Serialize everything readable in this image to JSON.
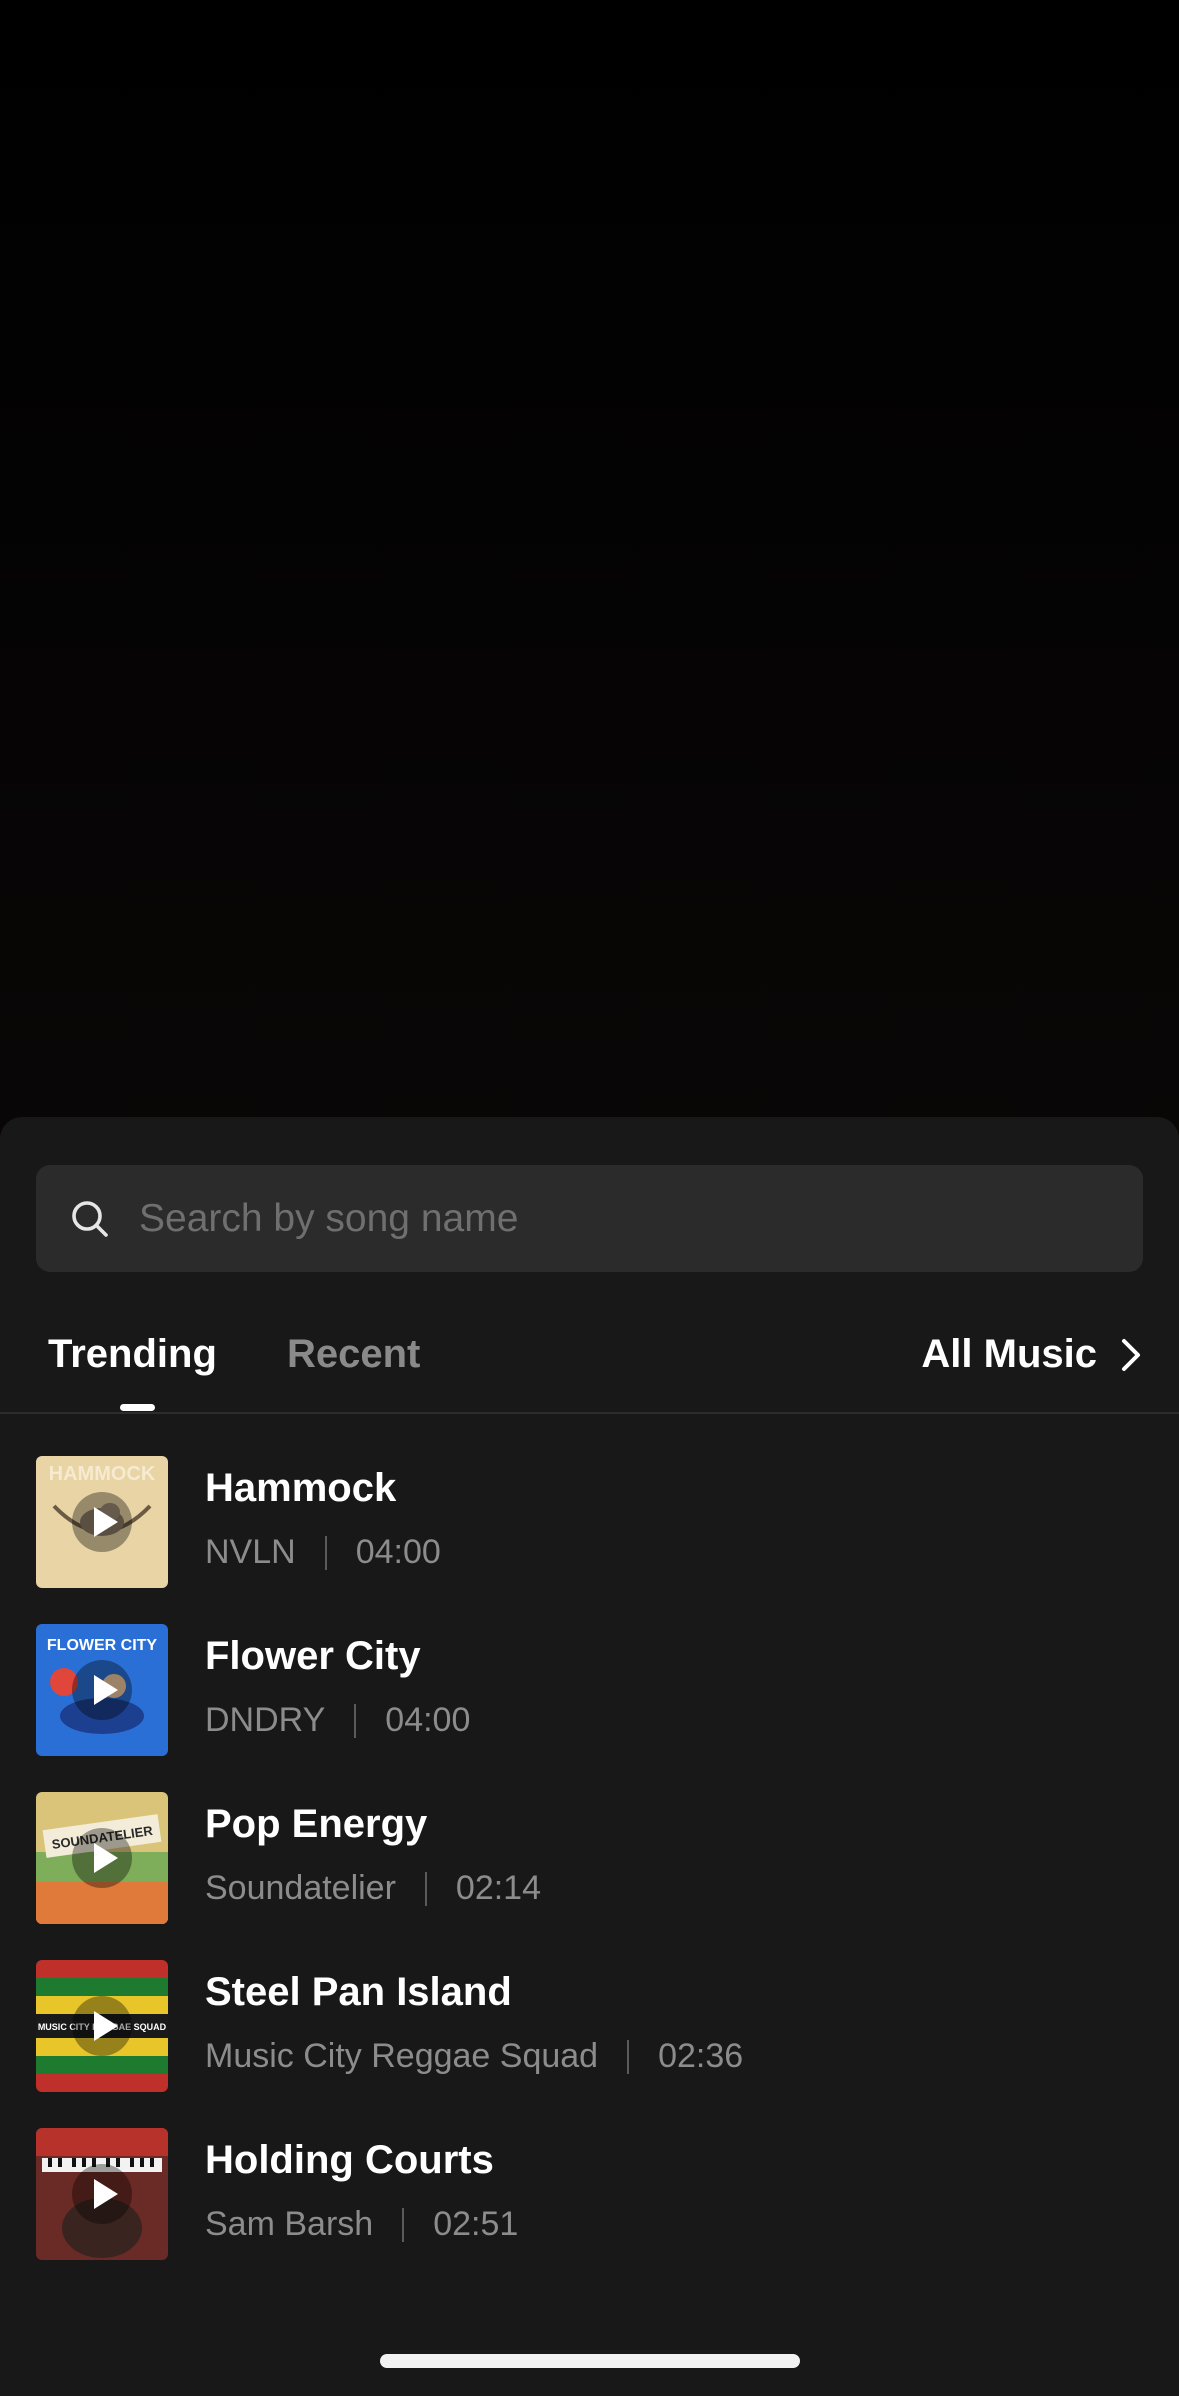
{
  "search": {
    "placeholder": "Search by song name",
    "icon": "search-icon"
  },
  "tabs": [
    {
      "label": "Trending",
      "active": true
    },
    {
      "label": "Recent",
      "active": false
    }
  ],
  "all_music": {
    "label": "All Music",
    "icon": "chevron-right-icon"
  },
  "songs": [
    {
      "title": "Hammock",
      "artist": "NVLN",
      "duration": "04:00",
      "cover_text": "HAMMOCK",
      "cover_color": "#e8d4a4"
    },
    {
      "title": "Flower City",
      "artist": "DNDRY",
      "duration": "04:00",
      "cover_text": "FLOWER CITY",
      "cover_color": "#2a6fd6"
    },
    {
      "title": "Pop Energy",
      "artist": "Soundatelier",
      "duration": "02:14",
      "cover_text": "SOUNDATELIER",
      "cover_color": "#d9c47a"
    },
    {
      "title": "Steel Pan Island",
      "artist": "Music City Reggae Squad",
      "duration": "02:36",
      "cover_text": "MUSIC CITY REGGAE SQUAD",
      "cover_color": "#1e7a2e"
    },
    {
      "title": "Holding Courts",
      "artist": "Sam Barsh",
      "duration": "02:51",
      "cover_text": "",
      "cover_color": "#6a2a26"
    }
  ],
  "colors": {
    "sheet_background": "#181818",
    "search_background": "#2b2b2b",
    "active_tab": "#ffffff",
    "inactive_tab": "#8a8a8a",
    "secondary_text": "#8c8c8c"
  }
}
